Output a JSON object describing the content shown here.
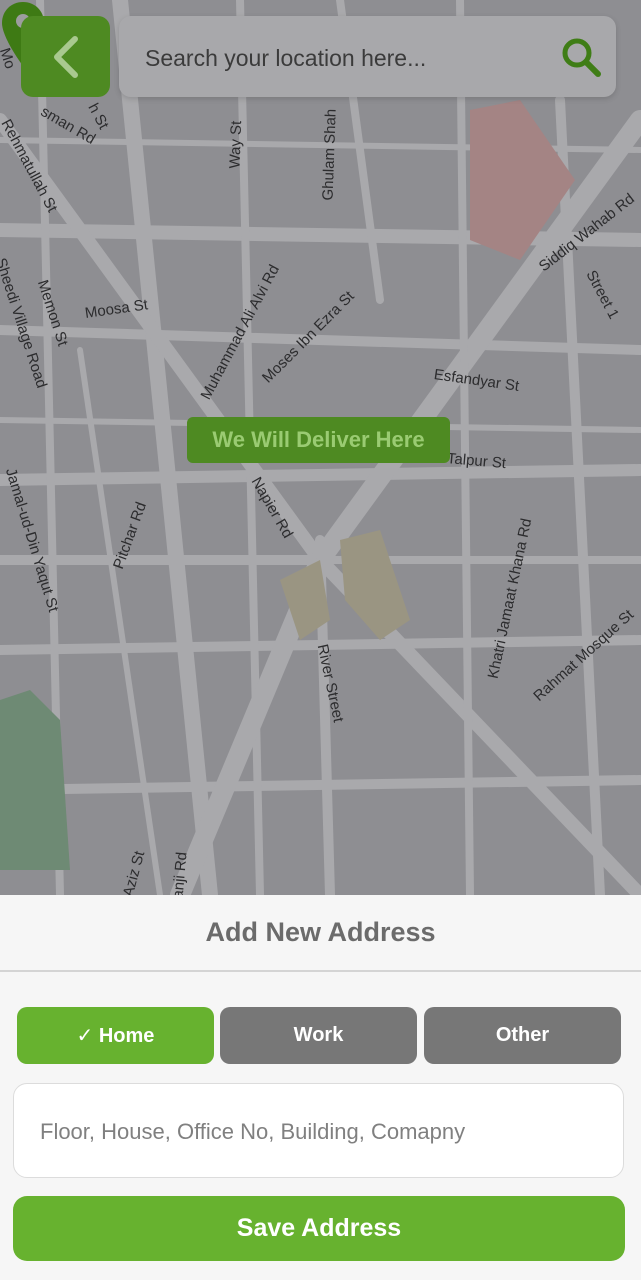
{
  "colors": {
    "brand_green": "#67b22f",
    "dark_green": "#4e8a22",
    "inactive_gray": "#777777",
    "map_overlay": "#8e8e92"
  },
  "map": {
    "streets": [
      "Rehmatullah St",
      "Memon St",
      "Moosa St",
      "Sheedi Village Road",
      "Jamal-ud-Din Yaqut St",
      "Pitchar Rd",
      "Muhammad Ali Alvi Rd",
      "Moses Ibn Ezra St",
      "Ghulam Shah",
      "Way St",
      "Siddiq Wahab Rd",
      "Street 1",
      "Esfandyar St",
      "Talpur St",
      "Napier Rd",
      "Khatri Jamaat Khana Rd",
      "Rahmat Mosque St",
      "River Street",
      "Aziz St",
      "anji Rd",
      "sman Rd",
      "Mo",
      "h St"
    ],
    "marker_label": "We Will Deliver Here",
    "marker_icon": "location-pin-icon"
  },
  "header": {
    "back_icon": "chevron-left-icon",
    "search_placeholder": "Search your location here...",
    "search_icon": "search-icon"
  },
  "sheet": {
    "title": "Add New Address",
    "address_types": [
      {
        "label": "✓ Home",
        "selected": true
      },
      {
        "label": "Work",
        "selected": false
      },
      {
        "label": "Other",
        "selected": false
      }
    ],
    "address_placeholder": "Floor, House, Office No, Building, Comapny",
    "save_label": "Save Address"
  }
}
